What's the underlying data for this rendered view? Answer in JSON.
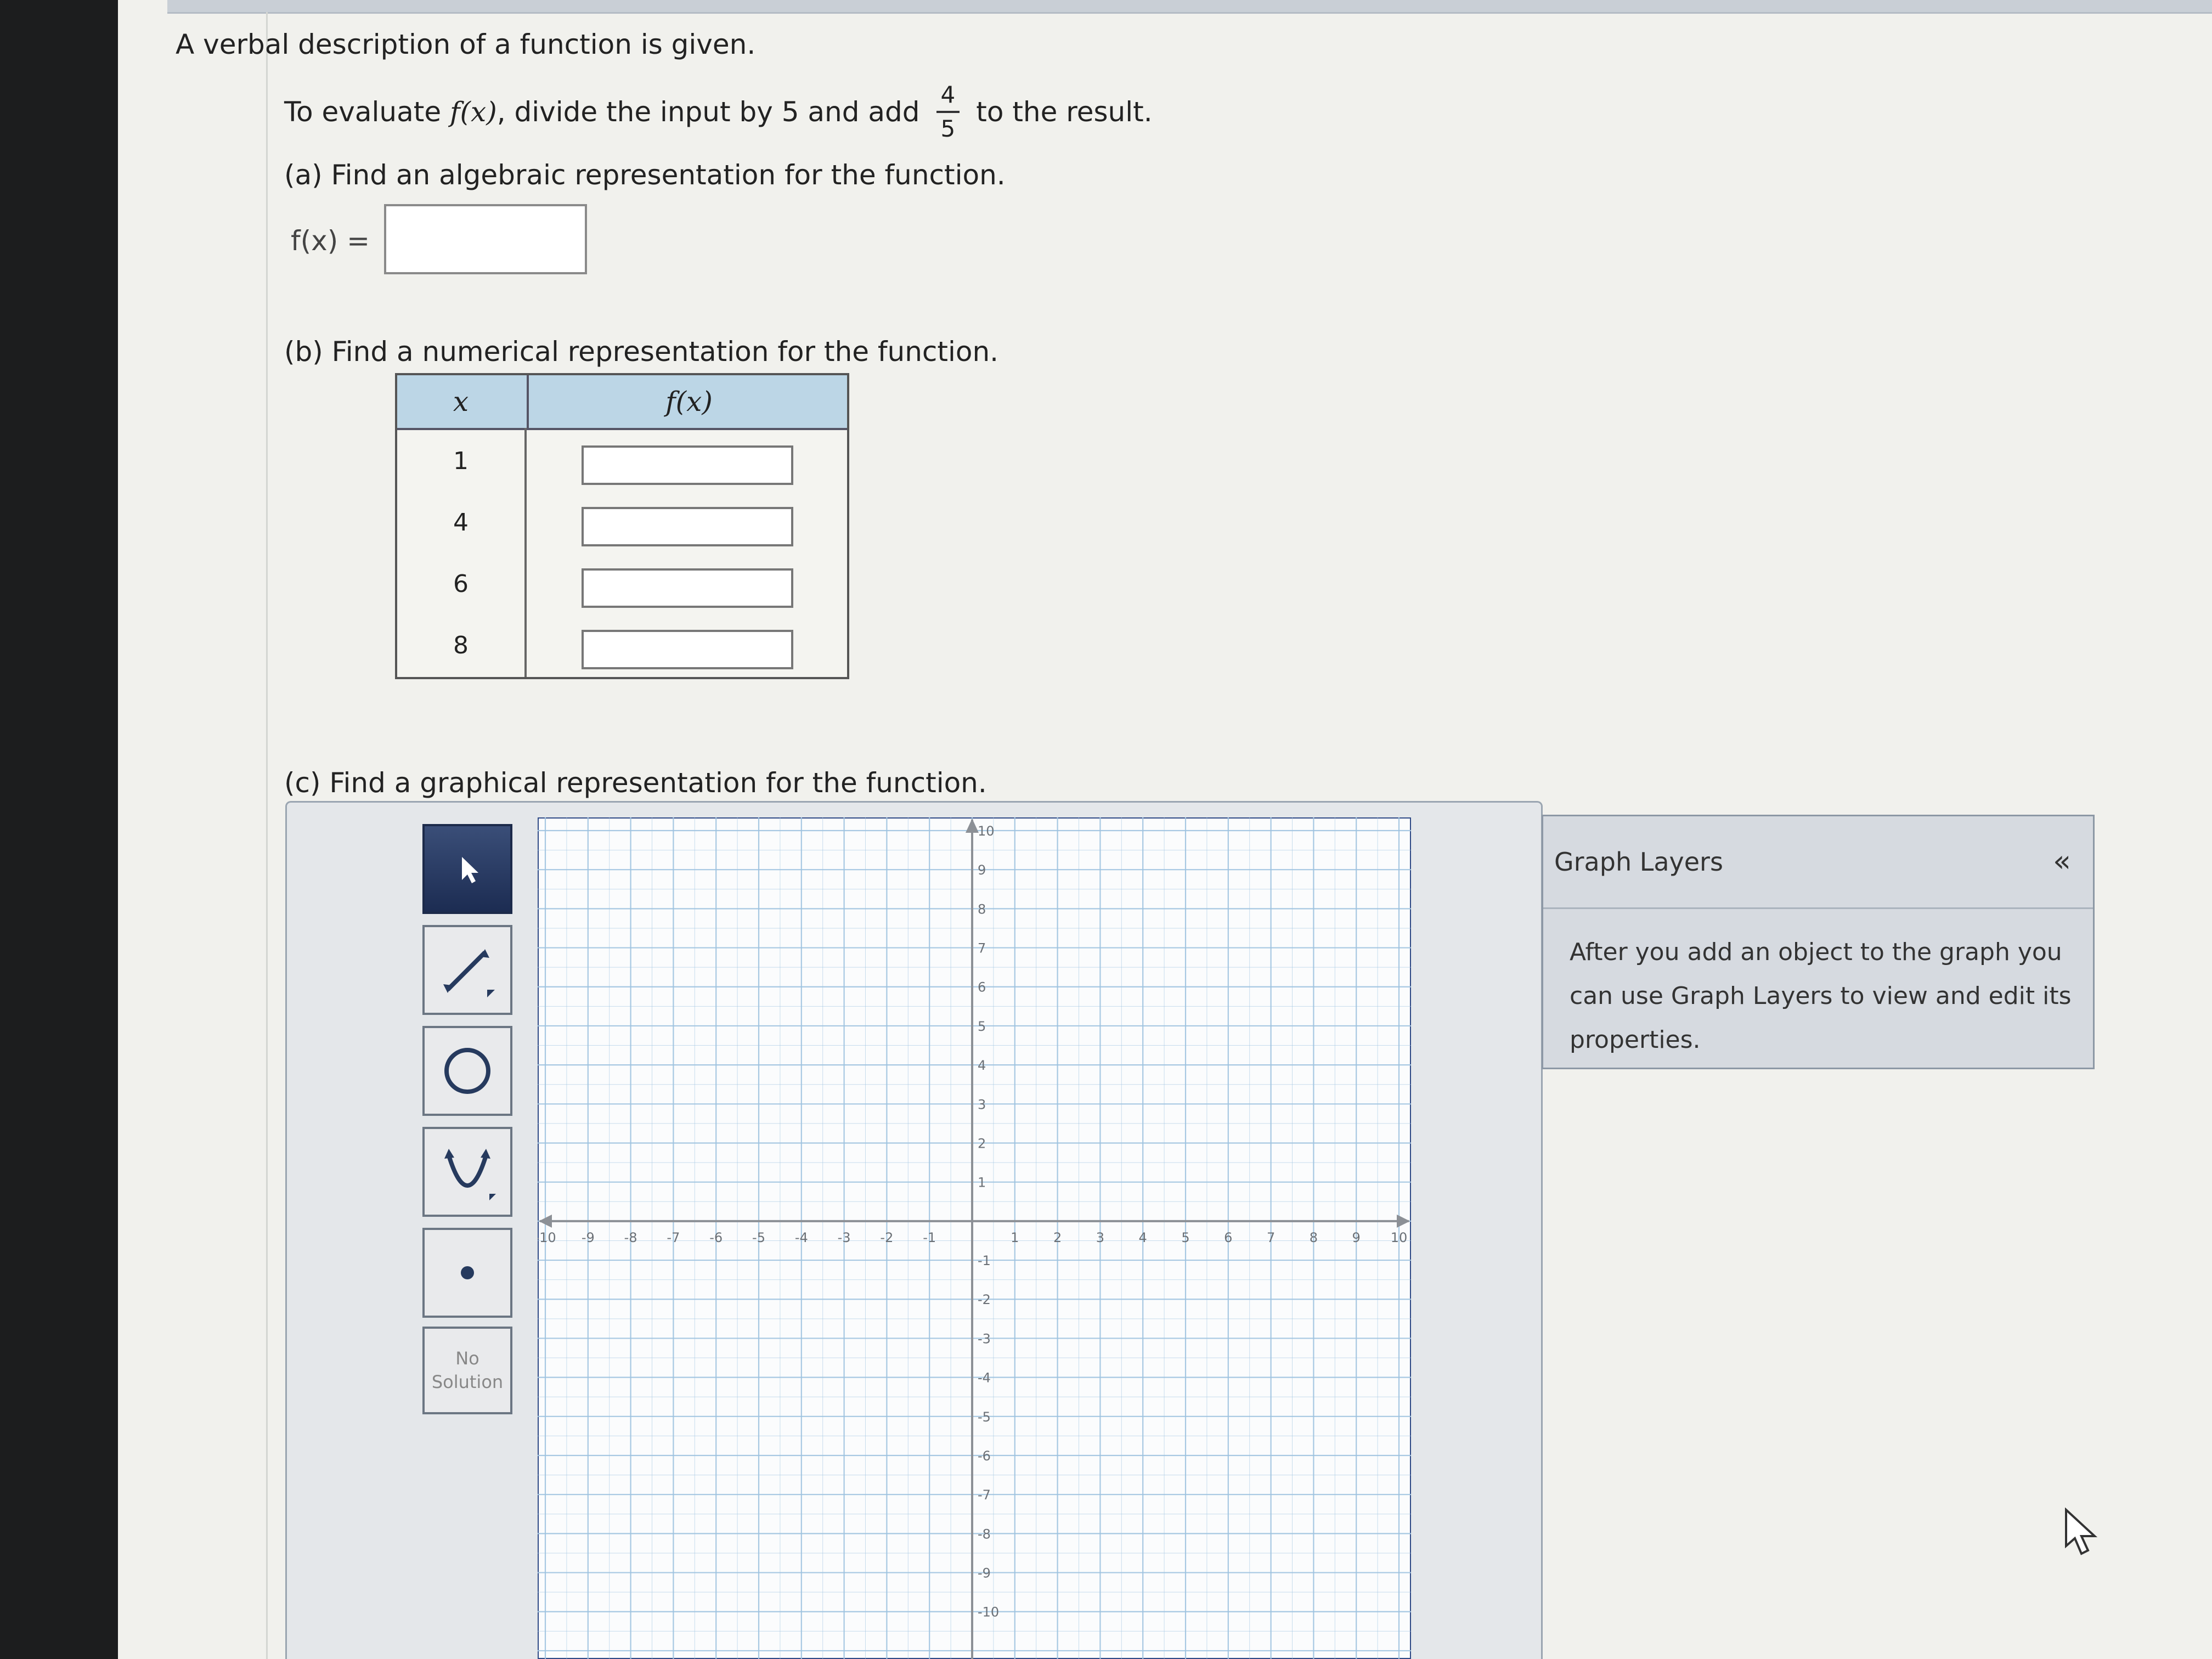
{
  "question": {
    "title": "A verbal description of a function is given.",
    "description_prefix": "To evaluate ",
    "function_notation": "f(x)",
    "description_mid": ", divide the input by 5 and add",
    "fraction_numerator": "4",
    "fraction_denominator": "5",
    "description_suffix": "to the result."
  },
  "part_a": {
    "prompt": "(a) Find an algebraic representation for the function.",
    "label": "f(x) =",
    "value": ""
  },
  "part_b": {
    "prompt": "(b) Find a numerical representation for the function.",
    "col_x": "x",
    "col_fx": "f(x)",
    "rows": [
      {
        "x": "1",
        "fx": ""
      },
      {
        "x": "4",
        "fx": ""
      },
      {
        "x": "6",
        "fx": ""
      },
      {
        "x": "8",
        "fx": ""
      }
    ]
  },
  "part_c": {
    "prompt": "(c) Find a graphical representation for the function.",
    "tools": [
      "pointer-tool",
      "line-tool",
      "circle-tool",
      "parabola-tool",
      "point-tool"
    ],
    "no_solution_line1": "No",
    "no_solution_line2": "Solution",
    "x_ticks": [
      "-10",
      "-9",
      "-8",
      "-7",
      "-6",
      "-5",
      "-4",
      "-3",
      "-2",
      "-1",
      "1",
      "2",
      "3",
      "4",
      "5",
      "6",
      "7",
      "8",
      "9",
      "10"
    ],
    "y_ticks_pos": [
      "10",
      "9",
      "8",
      "7",
      "6",
      "5",
      "4",
      "3",
      "2",
      "1"
    ],
    "y_ticks_neg": [
      "-1",
      "-2",
      "-3",
      "-4",
      "-5",
      "-6",
      "-7",
      "-8",
      "-9",
      "-10"
    ],
    "x_range": [
      -10,
      10
    ],
    "y_range": [
      -10,
      10
    ],
    "grid": true
  },
  "graph_layers": {
    "title": "Graph Layers",
    "collapse_glyph": "«",
    "body": "After you add an object to the graph you can use Graph Layers to view and edit its properties."
  },
  "colors": {
    "grid_line": "#9ec3e0",
    "axis": "#8c9096",
    "table_header": "#bcd6e6",
    "active_tool": "#23345c"
  }
}
